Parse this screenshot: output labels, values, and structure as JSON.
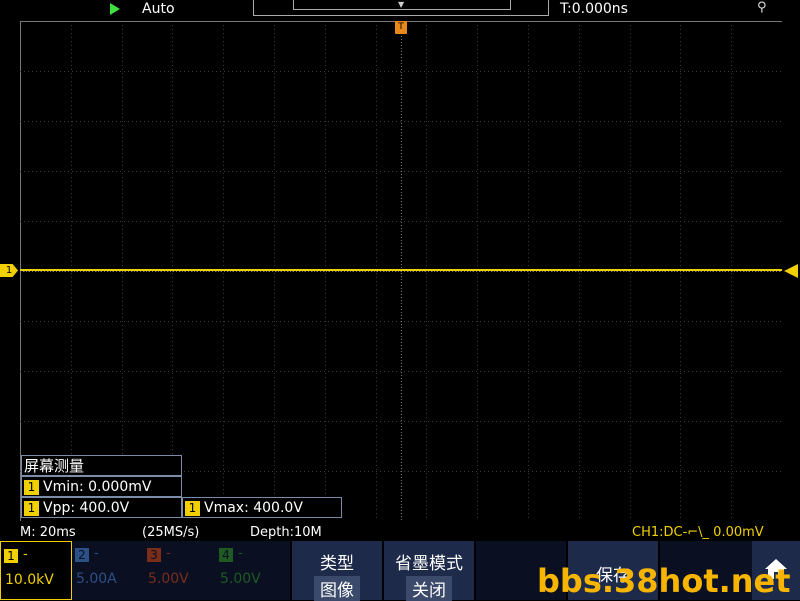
{
  "top_bar": {
    "run_mode": "Auto",
    "trigger_time": "T:0.000ns",
    "icons": [
      "run-icon",
      "usb-icon"
    ]
  },
  "scope": {
    "trigger_marker": "T",
    "channel_marker": "1",
    "trace_color": "#f0d000",
    "grid_color": "#3a3a3a"
  },
  "measurements": {
    "title": "屏幕测量",
    "channel": "1",
    "vmin": "Vmin: 0.000mV",
    "vpp": "Vpp: 400.0V",
    "vmax": "Vmax: 400.0V"
  },
  "status": {
    "timebase": "M: 20ms",
    "sample_rate": "(25MS/s)",
    "depth": "Depth:10M",
    "channel_info": "CH1:DC-⌐\\_ 0.00mV"
  },
  "channels": [
    {
      "num": "1",
      "dash": "-",
      "scale": "10.0kV",
      "color": "#f0d000"
    },
    {
      "num": "2",
      "dash": "-",
      "scale": "5.00A",
      "color": "#2c4f86"
    },
    {
      "num": "3",
      "dash": "-",
      "scale": "5.00V",
      "color": "#7a2e1a"
    },
    {
      "num": "4",
      "dash": "-",
      "scale": "5.00V",
      "color": "#1e5a22"
    }
  ],
  "menu": {
    "type_label": "类型",
    "type_value": "图像",
    "ink_label": "省墨模式",
    "ink_value": "关闭",
    "save_label": "保存"
  },
  "watermark": "bbs.38hot.net"
}
